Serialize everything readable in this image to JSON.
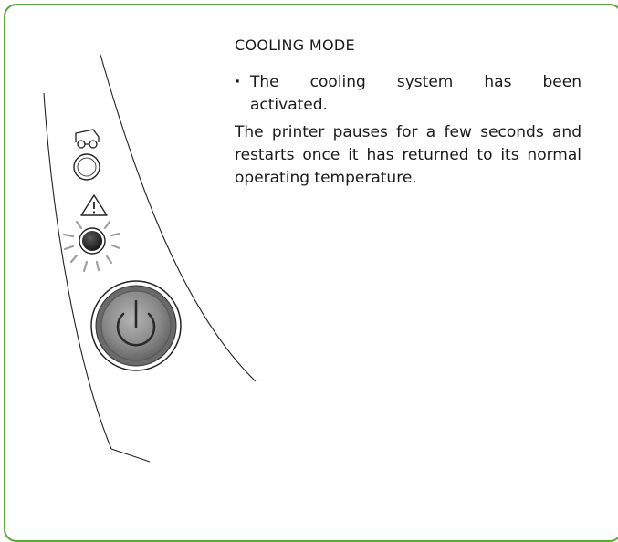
{
  "section": {
    "title": "COOLING MODE",
    "bullets": [
      {
        "line1": "The cooling system has been",
        "line2": "activated."
      }
    ],
    "body": "The printer pauses for a few seconds and restarts once it has returned to its normal operating temperature."
  },
  "colors": {
    "border": "#5aa83a",
    "text": "#1a1a1a",
    "led_blinking": "#2b2b2b",
    "power_button": "#8a8a8a"
  },
  "icons": {
    "ribbon": "ribbon-icon",
    "warning": "warning-icon",
    "power": "power-icon"
  },
  "indicators": {
    "ribbon_led": "off",
    "warning_led": "blinking",
    "power_button": "on"
  }
}
